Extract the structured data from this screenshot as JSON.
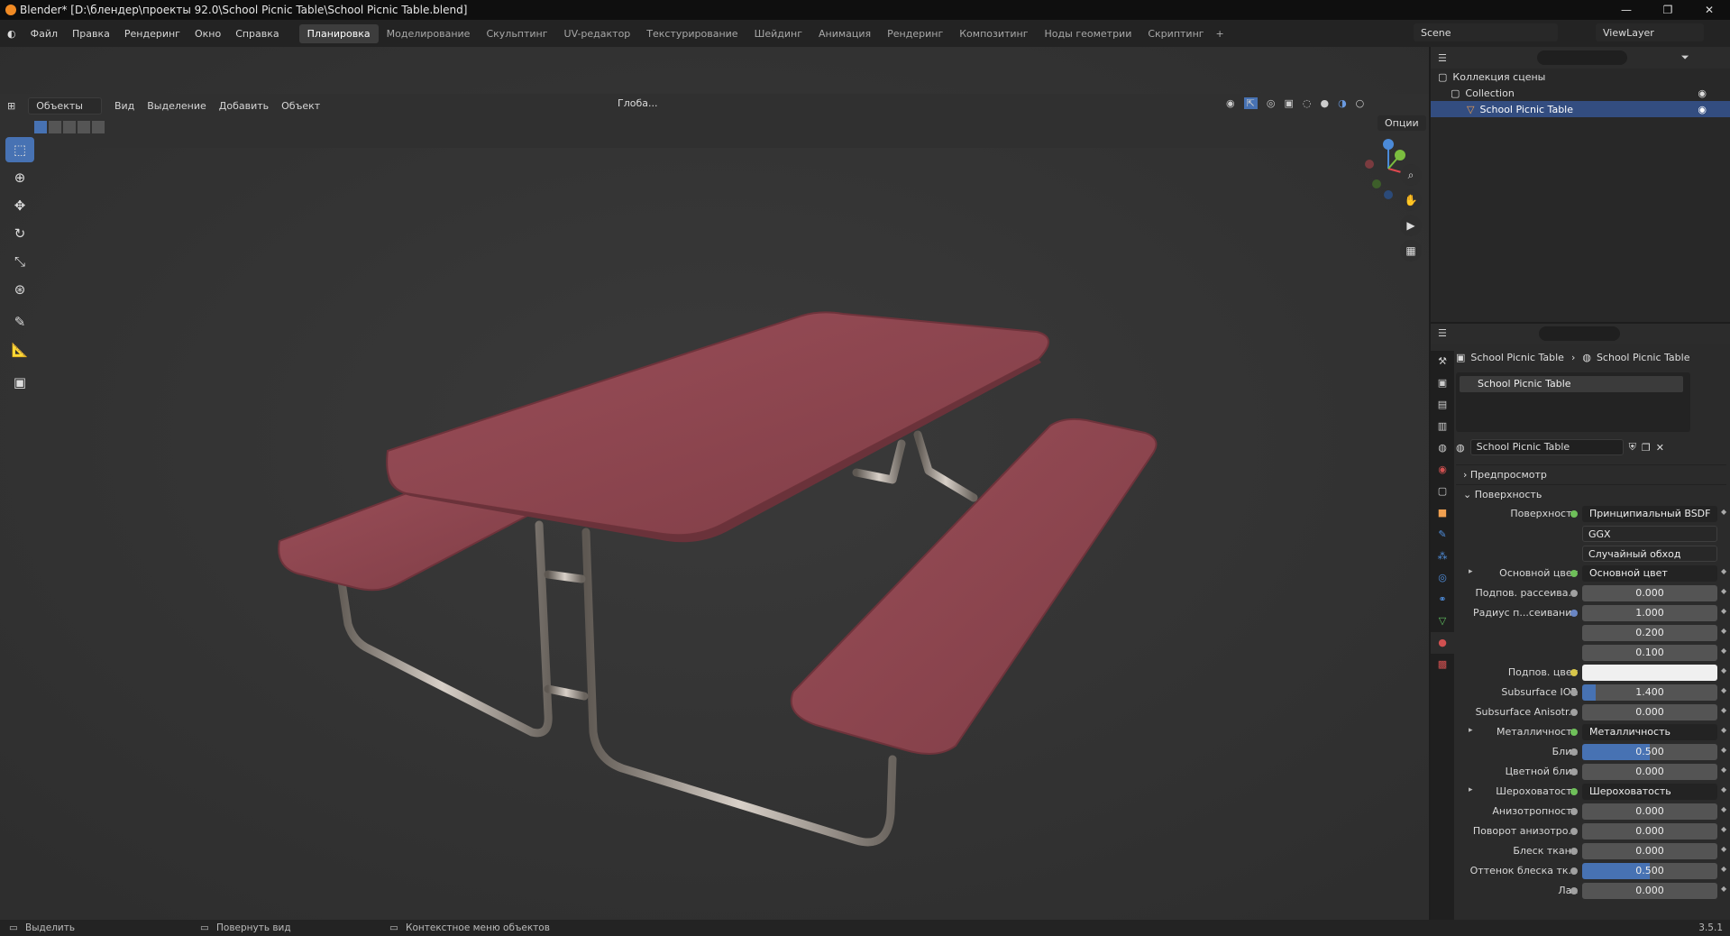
{
  "titlebar": {
    "title": "Blender* [D:\\блендер\\проекты 92.0\\School Picnic Table\\School Picnic Table.blend]"
  },
  "menu": [
    "Файл",
    "Правка",
    "Рендеринг",
    "Окно",
    "Справка"
  ],
  "workspaces": [
    "Планировка",
    "Моделирование",
    "Скульптинг",
    "UV-редактор",
    "Текстурирование",
    "Шейдинг",
    "Анимация",
    "Рендеринг",
    "Композитинг",
    "Ноды геометрии",
    "Скриптинг"
  ],
  "scene": "Scene",
  "viewlayer": "ViewLayer",
  "viewport_header": {
    "mode": "Объекты",
    "items": [
      "Вид",
      "Выделение",
      "Добавить",
      "Объект"
    ],
    "transform": "Глоба...",
    "options": "Опции"
  },
  "toolbar_icons": [
    "select-box-icon",
    "cursor-icon",
    "move-icon",
    "rotate-icon",
    "scale-icon",
    "transform-icon",
    "annotate-icon",
    "measure-icon",
    "add-cube-icon"
  ],
  "outliner": {
    "root": "Коллекция сцены",
    "collection": "Collection",
    "object": "School Picnic Table"
  },
  "properties": {
    "breadcrumb_obj": "School Picnic Table",
    "breadcrumb_mat": "School Picnic Table",
    "slot": "School Picnic Table",
    "material": "School Picnic Table",
    "sections": {
      "preview": "Предпросмотр",
      "surface": "Поверхность"
    },
    "rows": [
      {
        "label": "Поверхность",
        "value": "Принципиальный BSDF",
        "type": "link",
        "dot": "green"
      },
      {
        "label": "",
        "value": "GGX",
        "type": "dd"
      },
      {
        "label": "",
        "value": "Случайный обход",
        "type": "dd"
      },
      {
        "label": "Основной цвет",
        "value": "Основной цвет",
        "type": "link",
        "dot": "green",
        "tri": true
      },
      {
        "label": "Подпов. рассеива...",
        "value": "0.000",
        "type": "num",
        "dot": "gray"
      },
      {
        "label": "Радиус п...сеивания",
        "value": "1.000",
        "type": "num",
        "dot": "blue"
      },
      {
        "label": "",
        "value": "0.200",
        "type": "num"
      },
      {
        "label": "",
        "value": "0.100",
        "type": "num"
      },
      {
        "label": "Подпов. цвет",
        "value": "",
        "type": "white",
        "dot": "yellow"
      },
      {
        "label": "Subsurface IOR",
        "value": "1.400",
        "type": "ior",
        "dot": "gray"
      },
      {
        "label": "Subsurface Anisotr...",
        "value": "0.000",
        "type": "num",
        "dot": "gray"
      },
      {
        "label": "Металличность",
        "value": "Металличность",
        "type": "link",
        "dot": "green",
        "tri": true
      },
      {
        "label": "Блик",
        "value": "0.500",
        "type": "half",
        "dot": "gray"
      },
      {
        "label": "Цветной блик",
        "value": "0.000",
        "type": "num",
        "dot": "gray"
      },
      {
        "label": "Шероховатость",
        "value": "Шероховатость",
        "type": "link",
        "dot": "green",
        "tri": true
      },
      {
        "label": "Анизотропность",
        "value": "0.000",
        "type": "num",
        "dot": "gray"
      },
      {
        "label": "Поворот анизотро...",
        "value": "0.000",
        "type": "num",
        "dot": "gray"
      },
      {
        "label": "Блеск ткани",
        "value": "0.000",
        "type": "num",
        "dot": "gray"
      },
      {
        "label": "Оттенок блеска тк...",
        "value": "0.500",
        "type": "half",
        "dot": "gray"
      },
      {
        "label": "Лак",
        "value": "0.000",
        "type": "num",
        "dot": "gray"
      }
    ]
  },
  "status": {
    "left": "Выделить",
    "mid": "Повернуть вид",
    "right": "Контекстное меню объектов",
    "version": "3.5.1"
  },
  "colors": {
    "accent": "#4772b3",
    "table_red": "#8e4650",
    "metal": "#a8a19a"
  }
}
